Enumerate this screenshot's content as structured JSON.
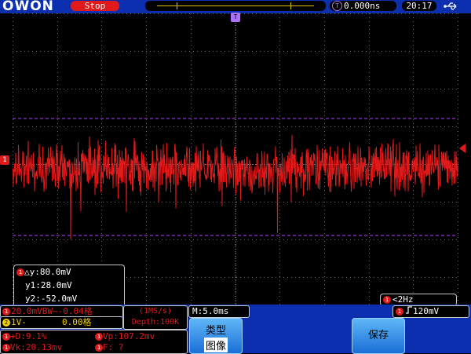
{
  "brand": "OWON",
  "status": {
    "run_state": "Stop"
  },
  "trigger_position": {
    "icon": "T",
    "value": "0.000ns"
  },
  "clock": "20:17",
  "icons": {
    "usb": "usb-icon",
    "trigger": "trigger-icon",
    "channel1": "channel-1-icon",
    "channel2": "channel-2-icon"
  },
  "colors": {
    "trace": "#e01a1a",
    "panel_bg": "#0c2fb0",
    "cursor_lines": "#b040ff",
    "button": "#3b95ea"
  },
  "channel_marker": "1",
  "cursors": {
    "delta": "△y:80.0mV",
    "y1": "y1:28.0mV",
    "y2": "y2:-52.0mV"
  },
  "frequency": "<2Hz",
  "ch1": {
    "label": "20.0mVBW~-0.04格"
  },
  "ch2": {
    "prefix": "2",
    "coupling": "1V-",
    "offset": "0.00格"
  },
  "sample": {
    "rate": "(1MS/s)",
    "depth": "Depth:100K"
  },
  "timebase": "M:5.0ms",
  "trigger": {
    "level": "120mV"
  },
  "measurements": {
    "plus_d": "+D:9.1%",
    "vp": "Vp:107.2mv",
    "vk": "Vk:20.13mv",
    "f": "F:  ?"
  },
  "menu": {
    "type_label": "类型",
    "type_value": "图像",
    "save_label": "保存"
  }
}
